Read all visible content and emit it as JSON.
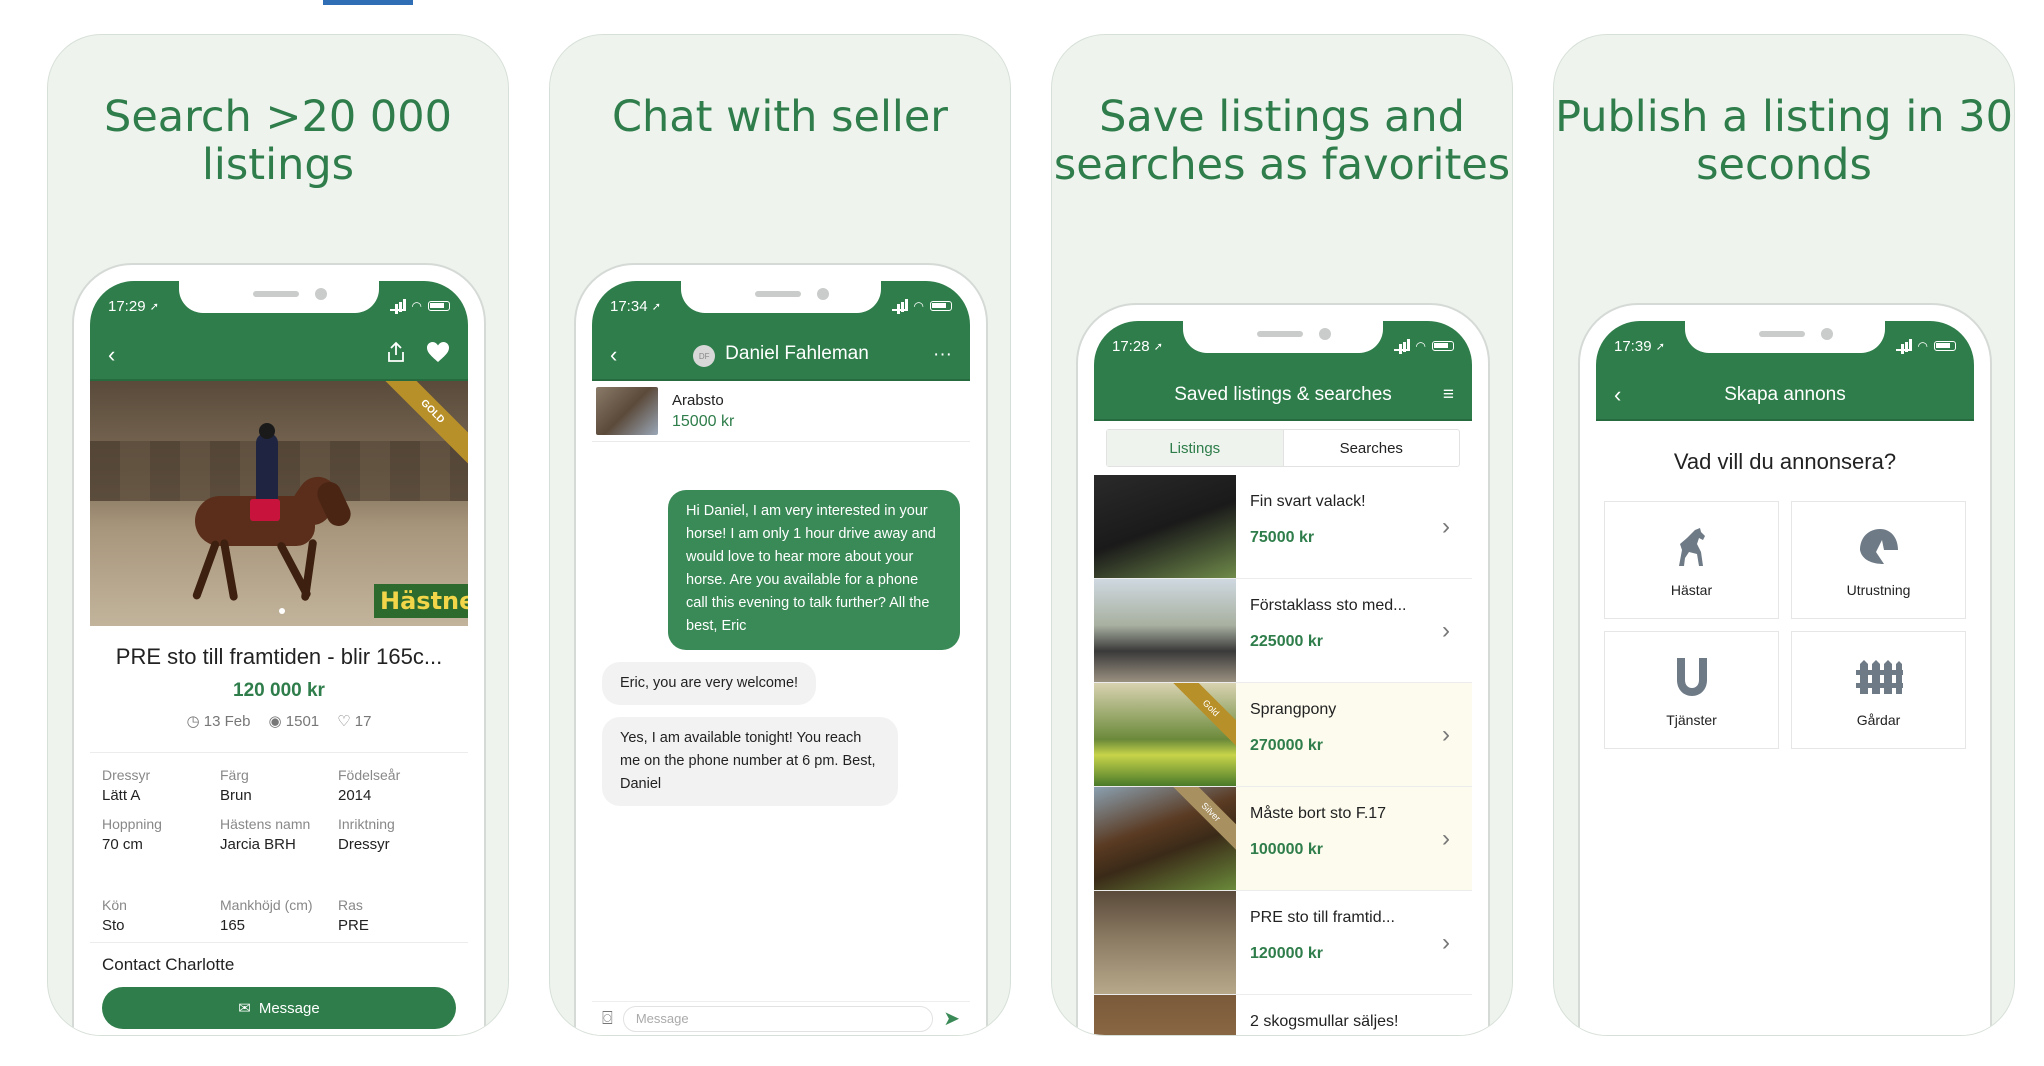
{
  "cards": [
    {
      "title": "Search >20 000 listings"
    },
    {
      "title": "Chat with seller"
    },
    {
      "title": "Save listings and searches as favorites"
    },
    {
      "title": "Publish a listing in 30 seconds"
    }
  ],
  "screen1": {
    "time": "17:29",
    "ribbon": "GOLD",
    "brand_sign": "Hästnet",
    "title": "PRE sto till framtiden - blir 165c...",
    "price": "120 000 kr",
    "date": "13 Feb",
    "views": "1501",
    "likes": "17",
    "attrs": [
      {
        "k": "Dressyr",
        "v": "Lätt A"
      },
      {
        "k": "Färg",
        "v": "Brun"
      },
      {
        "k": "Födelseår",
        "v": "2014"
      },
      {
        "k": "Hoppning",
        "v": "70 cm"
      },
      {
        "k": "Hästens namn",
        "v": "Jarcia BRH"
      },
      {
        "k": "Inriktning",
        "v": "Dressyr"
      },
      {
        "k": "Kön",
        "v": "Sto"
      },
      {
        "k": "Mankhöjd (cm)",
        "v": "165"
      },
      {
        "k": "Ras",
        "v": "PRE"
      }
    ],
    "contact": "Contact Charlotte",
    "message_btn": "Message"
  },
  "screen2": {
    "time": "17:34",
    "avatar_initials": "DF",
    "contact_name": "Daniel Fahleman",
    "listing_title": "Arabsto",
    "listing_price": "15000 kr",
    "msg_out": "Hi Daniel, I am very interested in your horse! I am only 1 hour drive away and would love to hear more about your horse. Are you available for a phone call this evening to talk further? All the best, Eric",
    "msg_in_1": "Eric, you are very welcome!",
    "msg_in_2": "Yes, I am available tonight! You reach me on the phone number at 6 pm. Best, Daniel",
    "composer_placeholder": "Message"
  },
  "screen3": {
    "time": "17:28",
    "title": "Saved listings & searches",
    "tab_listings": "Listings",
    "tab_searches": "Searches",
    "items": [
      {
        "title": "Fin svart valack!",
        "price": "75000 kr"
      },
      {
        "title": "Förstaklass sto med...",
        "price": "225000 kr"
      },
      {
        "title": "Sprangpony",
        "price": "270000 kr",
        "ribbon": "Gold"
      },
      {
        "title": "Måste bort sto F.17",
        "price": "100000 kr",
        "ribbon": "Silver"
      },
      {
        "title": "PRE sto till framtid...",
        "price": "120000 kr"
      },
      {
        "title": "2 skogsmullar säljes!",
        "price": ""
      }
    ]
  },
  "screen4": {
    "time": "17:39",
    "title": "Skapa annons",
    "question": "Vad vill du annonsera?",
    "categories": [
      "Hästar",
      "Utrustning",
      "Tjänster",
      "Gårdar"
    ]
  },
  "colors": {
    "brand_green": "#2e7d4a",
    "card_bg": "#eef3ee",
    "accent_blue": "#2f6eb5"
  }
}
